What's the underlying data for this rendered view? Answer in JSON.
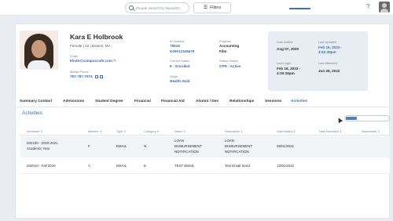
{
  "topbar": {
    "search_placeholder": "People Search by Name/ID",
    "filters_label": "Filters",
    "help_label": "?"
  },
  "profile": {
    "name": "Kara E Holbrook",
    "subinfo": "Female | 22 | Boston, MA",
    "email_label": "Email",
    "email": "kholb@campuscafe.com",
    "mobile_label": "Mobile Phone",
    "mobile": "787-787-7874",
    "id_label": "ID Number",
    "id": "78618",
    "id2": "K00012345678",
    "current_status_label": "Current Status",
    "current_status": "E - Enrolled",
    "holds_label": "Holds",
    "holds": "Health Hold",
    "program_label": "Program",
    "program_line1": "Accounting",
    "program_line2": "Film",
    "status_history_label": "Status History",
    "status_history": "CPR - Active"
  },
  "dates": {
    "date_added_label": "Date Added",
    "date_added": "Aug 07, 2000",
    "last_updated_label": "Last Updated",
    "last_updated_line1": "Feb 16, 2023 -",
    "last_updated_line2": "3:52:39pm",
    "last_login_label": "Last Login",
    "last_login_line1": "Feb 16, 2023 -",
    "last_login_line2": "4:33:16pm",
    "last_attended_label": "Last Attended",
    "last_attended": "Jun 28, 2022"
  },
  "tabs": [
    {
      "label": "Summary Contact"
    },
    {
      "label": "Admissions"
    },
    {
      "label": "Student Degree"
    },
    {
      "label": "Financial"
    },
    {
      "label": "Financial Aid"
    },
    {
      "label": "Alumni / Dev"
    },
    {
      "label": "Relationships"
    },
    {
      "label": "Sessions"
    },
    {
      "label": "Activities"
    }
  ],
  "section_title": "Activities",
  "table": {
    "columns": [
      "Semester ⇕",
      "Member ⇕",
      "Type ⇕",
      "Category ⇕",
      "Name ⇕",
      "Description ⇕",
      "Date Added ⇕",
      "Date Received ⇕",
      "Attachment ⇕"
    ],
    "rows": [
      {
        "semester_line1": "202100 - 2020-2021",
        "semester_line2": "Academic Year",
        "member": "F",
        "type": "EMAIL",
        "category": "N",
        "name_line1": "LOAN",
        "name_line2": "DISBURSEMENT",
        "name_line3": "NOTIFICATION",
        "desc_line1": "LOAN",
        "desc_line2": "DISBURSEMENT",
        "desc_line3": "NOTIFICATION",
        "date_added": "09/01/2021",
        "date_received": "",
        "attachment": ""
      },
      {
        "semester_line1": "202010 - Fall 2019",
        "member": "A",
        "type": "EMAIL",
        "category": "E",
        "name_line1": "TEST EMAIL",
        "desc_line1": "Test Email Send",
        "date_added": "12/01/2022",
        "date_received": "",
        "attachment": ""
      }
    ]
  },
  "colors": {
    "accent": "#3f6fb0",
    "background": "#e9edf2",
    "dates_panel": "#e8edf3"
  },
  "icons": [
    "search-icon",
    "filter-icon",
    "help-icon",
    "edit-pencil-icon",
    "chat-icon",
    "phone-icon",
    "user-avatar"
  ]
}
